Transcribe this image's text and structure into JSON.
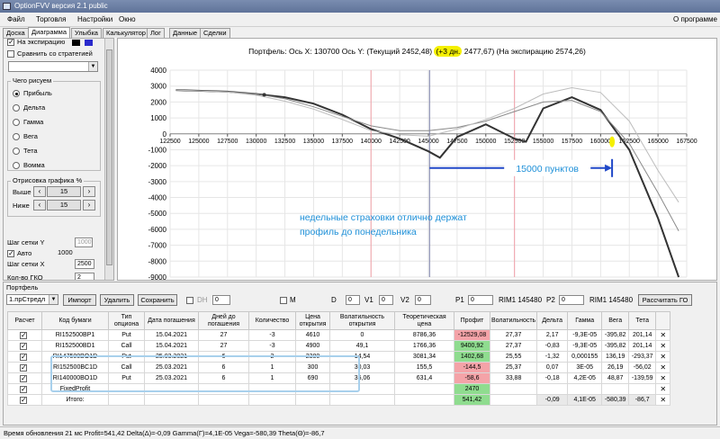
{
  "window": {
    "title": "OptionFVV версия 2.1 public"
  },
  "menu": {
    "items": [
      "Файл",
      "Торговля",
      "Настройки",
      "Окно"
    ],
    "about": "О программе"
  },
  "tabs": [
    "Доска",
    "Диаграмма",
    "Улыбка",
    "Калькулятор",
    "Лог",
    "Данные",
    "Сделки"
  ],
  "left_panel": {
    "expiry_label": "На экспирацию",
    "compare_label": "Сравнить со стратегией",
    "what_draw_title": "Чего рисуем",
    "options": [
      "Прибыль",
      "Дельта",
      "Гамма",
      "Вега",
      "Тета",
      "Вомма"
    ],
    "render_title": "Отрисовка графика %",
    "above_label": "Выше",
    "above_value": "15",
    "below_label": "Ниже",
    "below_value": "15",
    "grid_y_label": "Шаг сетки Y",
    "grid_y_value": "1000",
    "auto_label": "Авто",
    "auto_value": "1000",
    "grid_x_label": "Шаг сетки X",
    "grid_x_value": "2500",
    "count_label": "Кол-во ГКО",
    "count_value": "2"
  },
  "chart_header": {
    "text1": "Портфель: Ось X: 130700 Ось Y:",
    "text2": "(Текущий 2452,48)",
    "text3": "(+3 дн.",
    "text4": "2477,67)",
    "text5": "(На экспирацию 2574,26)"
  },
  "annotations": {
    "distance": "15000 пунктов",
    "note_line1": "недельные страховки отлично держат",
    "note_line2": "профиль до понедельника"
  },
  "chart_data": {
    "type": "line",
    "xlim": [
      122500,
      167500
    ],
    "ylim": [
      -9000,
      4000
    ],
    "x_ticks": [
      122500,
      125000,
      127500,
      130000,
      132500,
      135000,
      137500,
      140000,
      142500,
      145000,
      147500,
      150000,
      152500,
      155000,
      157500,
      160000,
      162500,
      165000,
      167500
    ],
    "y_ticks": [
      4000,
      3000,
      2000,
      1000,
      0,
      -1000,
      -2000,
      -3000,
      -4000,
      -5000,
      -6000,
      -7000,
      -8000,
      -9000
    ],
    "current_x": 145100,
    "series": [
      {
        "name": "Текущий",
        "x": [
          123000,
          127500,
          130000,
          132500,
          135000,
          137500,
          140000,
          142500,
          145000,
          146000,
          147500,
          150000,
          152500,
          153500,
          155000,
          157500,
          160000,
          162500,
          165000,
          166800
        ],
        "y": [
          2750,
          2650,
          2500,
          2300,
          1900,
          1200,
          300,
          -300,
          -1100,
          -1500,
          -200,
          600,
          -300,
          -500,
          1600,
          2300,
          1500,
          -1000,
          -5300,
          -9000
        ]
      },
      {
        "name": "+3 дн.",
        "x": [
          123000,
          127500,
          130000,
          132500,
          135000,
          137500,
          140000,
          142500,
          145000,
          147500,
          150000,
          152500,
          155000,
          157500,
          160000,
          162500,
          165000,
          166800
        ],
        "y": [
          2750,
          2650,
          2500,
          2200,
          1700,
          1100,
          500,
          200,
          200,
          400,
          800,
          1400,
          2000,
          2100,
          1400,
          -600,
          -3700,
          -6100
        ]
      },
      {
        "name": "На экспирацию",
        "x": [
          123000,
          127500,
          130000,
          132500,
          135000,
          137500,
          140000,
          142500,
          145000,
          147500,
          150000,
          152500,
          155000,
          157500,
          160000,
          162500,
          165000,
          166800
        ],
        "y": [
          2750,
          2620,
          2430,
          2050,
          1550,
          900,
          200,
          -50,
          -150,
          300,
          900,
          1600,
          2500,
          2900,
          2600,
          800,
          -2300,
          -4300
        ]
      }
    ],
    "markers": [
      {
        "x": 130700,
        "y": 2450
      }
    ]
  },
  "portfolio": {
    "title": "Портфель",
    "selector": "1.прСтредл",
    "import_label": "Импорт",
    "delete_label": "Удалить",
    "save_label": "Сохранить",
    "dh_label": "DH",
    "dh_value": "0",
    "m_label": "M",
    "d_label": "D",
    "d_value": "0",
    "v1_label": "V1",
    "v1_value": "0",
    "v2_label": "V2",
    "v2_value": "0",
    "p1_label": "P1",
    "p1_value": "0",
    "rim_label1": "RIM1 145480",
    "p2_label": "P2",
    "p2_value": "0",
    "rim_label2": "RIM1 145480",
    "calc_label": "Рассчитать ГО",
    "columns": [
      "Расчет",
      "Код бумаги",
      "Тип опциона",
      "Дата погашения",
      "Дней до погашения",
      "Количество",
      "Цена открытия",
      "Волатильность открытия",
      "Теоретическая цена",
      "Профит",
      "Волатильность",
      "Дельта",
      "Гамма",
      "Вега",
      "Тета",
      ""
    ],
    "rows": [
      [
        "",
        "RI152500BP1",
        "Put",
        "15.04.2021",
        "27",
        "-3",
        "4610",
        "0",
        "8786,36",
        "-12529,08",
        "27,37",
        "2,17",
        "-9,3E-05",
        "-395,82",
        "201,14",
        "✕"
      ],
      [
        "",
        "RI152500BD1",
        "Call",
        "15.04.2021",
        "27",
        "-3",
        "4900",
        "49,1",
        "1766,36",
        "9400,92",
        "27,37",
        "-0,83",
        "-9,3E-05",
        "-395,82",
        "201,14",
        "✕"
      ],
      [
        "",
        "RI147500BO1D",
        "Put",
        "25.03.2021",
        "6",
        "2",
        "2380",
        "14,54",
        "3081,34",
        "1402,68",
        "25,55",
        "-1,32",
        "0,000155",
        "136,19",
        "-293,37",
        "✕"
      ],
      [
        "",
        "RI152500BC1D",
        "Call",
        "25.03.2021",
        "6",
        "1",
        "300",
        "30,03",
        "155,5",
        "-144,5",
        "25,37",
        "0,07",
        "3E-05",
        "26,19",
        "-56,02",
        "✕"
      ],
      [
        "",
        "RI140000BO1D",
        "Put",
        "25.03.2021",
        "6",
        "1",
        "690",
        "35,06",
        "631,4",
        "-58,6",
        "33,88",
        "-0,18",
        "4,2E-05",
        "48,87",
        "-139,59",
        "✕"
      ],
      [
        "",
        "FixedProfit",
        "",
        "",
        "",
        "",
        "",
        "",
        "",
        "2470",
        "",
        "",
        "",
        "",
        "",
        "✕"
      ],
      [
        "",
        "Итого:",
        "",
        "",
        "",
        "",
        "",
        "",
        "",
        "541,42",
        "",
        "-0,09",
        "4,1E-05",
        "-580,39",
        "-86,7",
        "✕"
      ]
    ],
    "profit_colors": [
      "neg",
      "pos",
      "pos",
      "neg",
      "neg",
      "pos",
      "pos"
    ]
  },
  "status": {
    "text": "Время обновления 21 мс  Profit=541,42 Delta(Δ)=-0,09 Gamma(Γ)=4,1E-05 Vega=-580,39 Theta(Θ)=-86,7"
  },
  "colors": {
    "highlight_yellow": "#f5f000",
    "annotation_blue": "#1e90d8",
    "arrow_blue": "#2048c8"
  }
}
